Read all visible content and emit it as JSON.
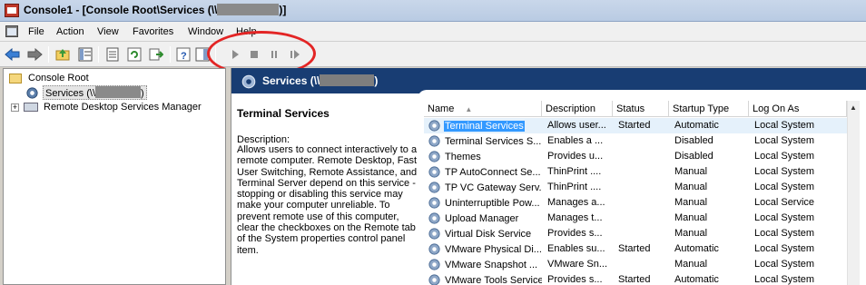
{
  "window": {
    "title_prefix": "Console1 - [Console Root\\Services (\\\\",
    "title_suffix": ")]"
  },
  "menu": [
    "File",
    "Action",
    "View",
    "Favorites",
    "Window",
    "Help"
  ],
  "toolbar": {
    "buttons": [
      "back-icon",
      "forward-icon",
      "up-folder-icon",
      "show-hide-tree-icon",
      "properties-icon",
      "refresh-icon",
      "export-list-icon",
      "help-icon",
      "console-tree-icon",
      "start-service-icon",
      "stop-service-icon",
      "pause-service-icon",
      "resume-service-icon"
    ],
    "highlight_color": "#e32525"
  },
  "tree": {
    "root": "Console Root",
    "services": "Services (\\\\",
    "services_suffix": ")",
    "rds_manager": "Remote Desktop Services Manager",
    "expander": "+"
  },
  "details": {
    "header_prefix": "Services (\\\\",
    "header_suffix": ")",
    "service_name": "Terminal Services",
    "description_label": "Description:",
    "description": "Allows users to connect interactively to a remote computer. Remote Desktop, Fast User Switching, Remote Assistance, and Terminal Server depend on this service - stopping or disabling this service may make your computer unreliable.  To prevent remote use of this computer, clear the checkboxes on the Remote tab of the System properties control panel item."
  },
  "list": {
    "columns": [
      "Name",
      "Description",
      "Status",
      "Startup Type",
      "Log On As"
    ],
    "rows": [
      {
        "name": "Terminal Services",
        "description": "Allows user...",
        "status": "Started",
        "startup": "Automatic",
        "logon": "Local System"
      },
      {
        "name": "Terminal Services S...",
        "description": "Enables a ...",
        "status": "",
        "startup": "Disabled",
        "logon": "Local System"
      },
      {
        "name": "Themes",
        "description": "Provides u...",
        "status": "",
        "startup": "Disabled",
        "logon": "Local System"
      },
      {
        "name": "TP AutoConnect Se...",
        "description": "ThinPrint ....",
        "status": "",
        "startup": "Manual",
        "logon": "Local System"
      },
      {
        "name": "TP VC Gateway Serv...",
        "description": "ThinPrint ....",
        "status": "",
        "startup": "Manual",
        "logon": "Local System"
      },
      {
        "name": "Uninterruptible Pow...",
        "description": "Manages a...",
        "status": "",
        "startup": "Manual",
        "logon": "Local Service"
      },
      {
        "name": "Upload Manager",
        "description": "Manages t...",
        "status": "",
        "startup": "Manual",
        "logon": "Local System"
      },
      {
        "name": "Virtual Disk Service",
        "description": "Provides s...",
        "status": "",
        "startup": "Manual",
        "logon": "Local System"
      },
      {
        "name": "VMware Physical Di...",
        "description": "Enables su...",
        "status": "Started",
        "startup": "Automatic",
        "logon": "Local System"
      },
      {
        "name": "VMware Snapshot ...",
        "description": "VMware Sn...",
        "status": "",
        "startup": "Manual",
        "logon": "Local System"
      },
      {
        "name": "VMware Tools Service",
        "description": "Provides s...",
        "status": "Started",
        "startup": "Automatic",
        "logon": "Local System"
      }
    ]
  }
}
